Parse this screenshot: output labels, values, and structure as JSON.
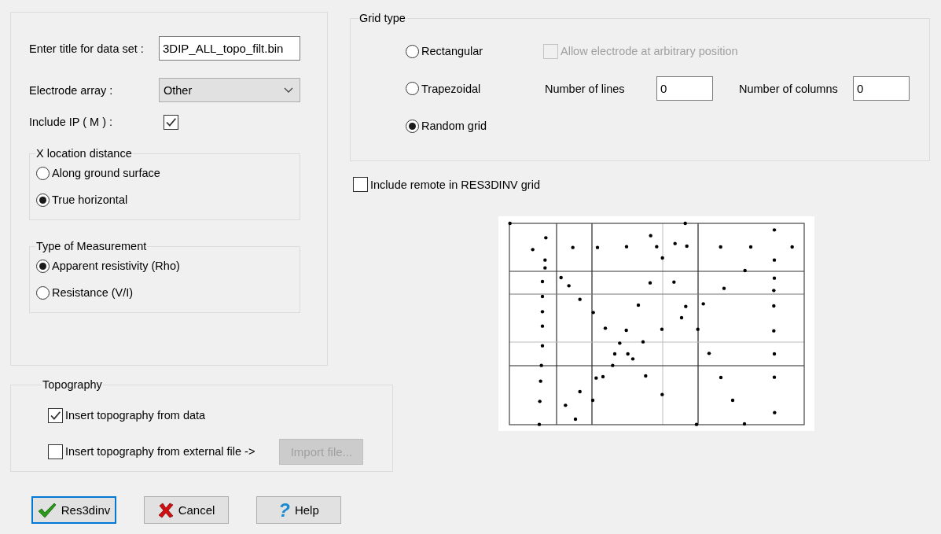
{
  "title_field": {
    "label": "Enter title for data set :",
    "value": "3DIP_ALL_topo_filt.bin"
  },
  "electrode_array": {
    "label": "Electrode array :",
    "value": "Other"
  },
  "include_ip": {
    "label": "Include IP ( M ) :",
    "checked": true
  },
  "x_location_distance": {
    "title": "X location distance",
    "options": [
      {
        "label": "Along ground surface",
        "selected": false
      },
      {
        "label": "True horizontal",
        "selected": true
      }
    ]
  },
  "measurement_type": {
    "title": "Type of Measurement",
    "options": [
      {
        "label": "Apparent resistivity (Rho)",
        "selected": true
      },
      {
        "label": "Resistance (V/I)",
        "selected": false
      }
    ]
  },
  "grid_type": {
    "title": "Grid type",
    "options": [
      {
        "label": "Rectangular",
        "selected": false
      },
      {
        "label": "Trapezoidal",
        "selected": false
      },
      {
        "label": "Random grid",
        "selected": true
      }
    ],
    "arbitrary_position": {
      "label": "Allow electrode at arbitrary position",
      "checked": false,
      "disabled": true
    },
    "lines": {
      "label": "Number of lines",
      "value": "0"
    },
    "columns": {
      "label": "Number of columns",
      "value": "0"
    }
  },
  "include_remote": {
    "label": "Include remote in RES3DINV grid",
    "checked": false
  },
  "topography": {
    "title": "Topography",
    "options": [
      {
        "label": "Insert topography from data",
        "checked": true
      },
      {
        "label": "Insert topography from external file ->",
        "checked": false
      }
    ],
    "import_button": {
      "label": "Import file...",
      "disabled": true
    }
  },
  "buttons": [
    {
      "label": "Res3dinv",
      "kind": "ok",
      "focused": true
    },
    {
      "label": "Cancel",
      "kind": "cancel",
      "focused": false
    },
    {
      "label": "Help",
      "kind": "help",
      "focused": false,
      "glyph": "?"
    }
  ]
}
